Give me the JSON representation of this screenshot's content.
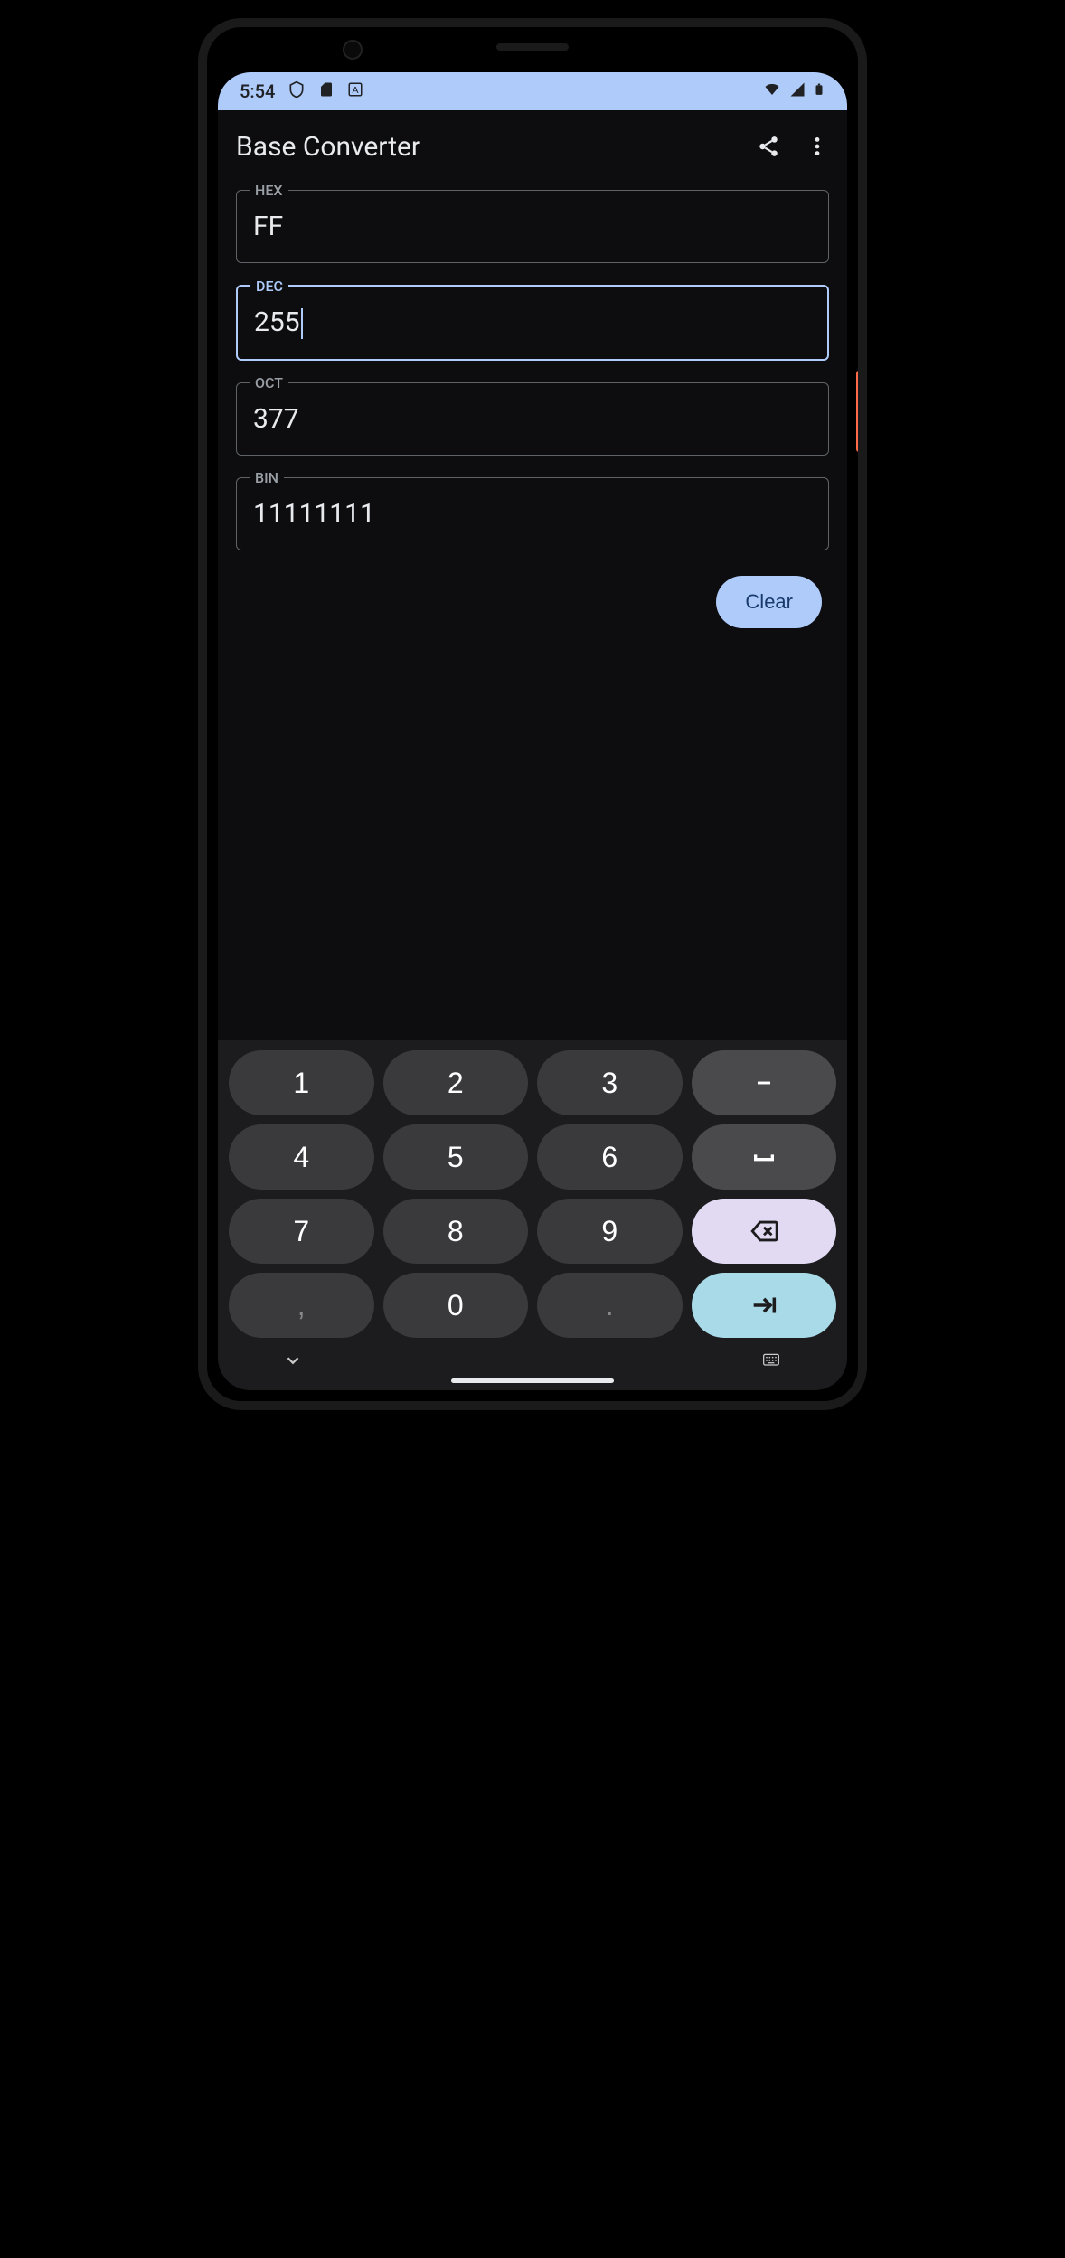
{
  "status": {
    "time": "5:54"
  },
  "app": {
    "title": "Base Converter"
  },
  "fields": {
    "hex": {
      "label": "HEX",
      "value": "FF"
    },
    "dec": {
      "label": "DEC",
      "value": "255"
    },
    "oct": {
      "label": "OCT",
      "value": "377"
    },
    "bin": {
      "label": "BIN",
      "value": "11111111"
    }
  },
  "buttons": {
    "clear": "Clear"
  },
  "keyboard": {
    "keys": [
      "1",
      "2",
      "3",
      "–",
      "4",
      "5",
      "6",
      "␣",
      "7",
      "8",
      "9",
      "⌫",
      ",",
      "0",
      ".",
      "⇥"
    ]
  },
  "colors": {
    "accent": "#aecbfa",
    "background": "#0d0d10",
    "keyboard_bg": "#1c1c1e",
    "backspace_key": "#e2d9f3",
    "enter_key": "#a8dae8"
  }
}
